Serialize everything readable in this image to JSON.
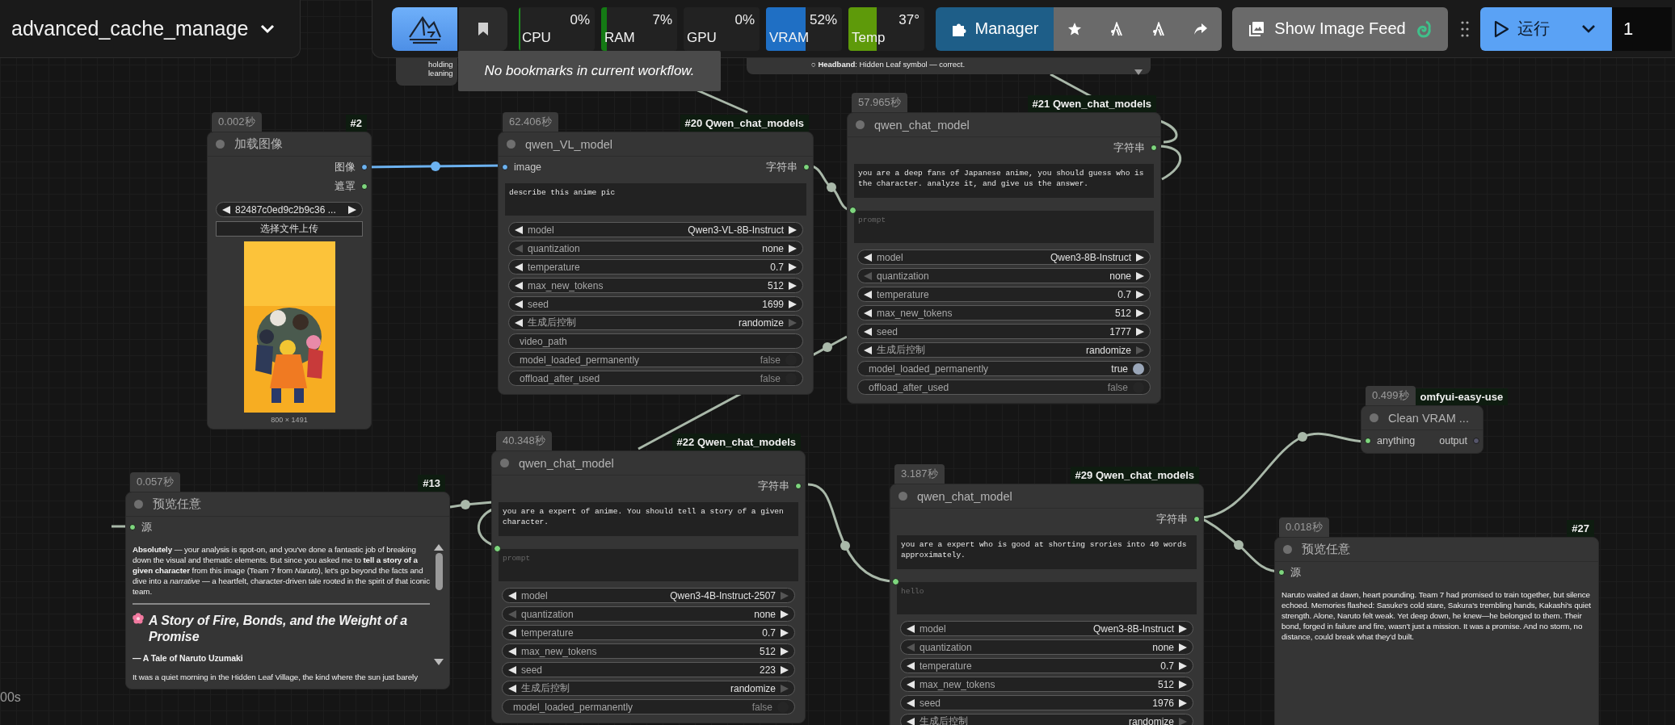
{
  "workflow": {
    "title": "advanced_cache_manage"
  },
  "toolbar": {
    "tooltip": "No bookmarks in current workflow.",
    "monitors": [
      {
        "label": "CPU",
        "reading": "0%",
        "level": 0.02,
        "color": "#1f8f1f"
      },
      {
        "label": "RAM",
        "reading": "7%",
        "level": 0.07,
        "color": "#147a14"
      },
      {
        "label": "GPU",
        "reading": "0%"
      },
      {
        "label": "VRAM",
        "reading": "52%",
        "level": 0.52,
        "color": "#1f6fc4"
      },
      {
        "label": "Temp",
        "reading": "37°",
        "level": 0.37,
        "color": "#5e9a0a"
      }
    ],
    "manager": "Manager",
    "image_feed": "Show Image Feed",
    "run": "运行",
    "queue_count": "1"
  },
  "partial_nodes": [
    {
      "lines": [
        "holding",
        "leaning"
      ]
    },
    {
      "lines": [
        "○ **Headband**: Hidden Leaf symbol — correct."
      ]
    }
  ],
  "nodes": [
    {
      "kind": "load_image",
      "badge": "0.002秒",
      "tag": "#2",
      "title": "加载图像",
      "outputs": [
        {
          "label": "图像",
          "color": "#6cb2f0"
        },
        {
          "label": "遮罩",
          "color": "#7ed67e"
        }
      ],
      "file": "82487c0ed9c2b9c36 ...",
      "upload": "选择文件上传",
      "caption": "800 × 1491"
    },
    {
      "kind": "qwen",
      "badge": "62.406秒",
      "tag": "#20 Qwen_chat_models",
      "title": "qwen_VL_model",
      "inputs": [
        {
          "label": "image",
          "color": "#6cb2f0"
        }
      ],
      "outputs": [
        {
          "label": "字符串",
          "color": "#7ed67e"
        }
      ],
      "system_text": "describe this anime pic",
      "widgets": [
        {
          "kind": "combo",
          "label": "model",
          "value": "Qwen3-VL-8B-Instruct",
          "prev_disabled": false,
          "next_disabled": false
        },
        {
          "kind": "combo",
          "label": "quantization",
          "value": "none",
          "prev_disabled": true,
          "next_disabled": false
        },
        {
          "kind": "number",
          "label": "temperature",
          "value": "0.7",
          "prev_disabled": false,
          "next_disabled": false
        },
        {
          "kind": "number",
          "label": "max_new_tokens",
          "value": "512",
          "prev_disabled": false,
          "next_disabled": false
        },
        {
          "kind": "number",
          "label": "seed",
          "value": "1699",
          "prev_disabled": false,
          "next_disabled": false
        },
        {
          "kind": "combo",
          "label": "生成后控制",
          "value": "randomize",
          "prev_disabled": false,
          "next_disabled": true
        },
        {
          "kind": "text",
          "label": "video_path"
        },
        {
          "kind": "toggle",
          "label": "model_loaded_permanently",
          "value": "false",
          "on": false
        },
        {
          "kind": "toggle",
          "label": "offload_after_used",
          "value": "false",
          "on": false
        }
      ]
    },
    {
      "kind": "qwen",
      "badge": "57.965秒",
      "tag": "#21 Qwen_chat_models",
      "title": "qwen_chat_model",
      "outputs": [
        {
          "label": "字符串",
          "color": "#7ed67e"
        }
      ],
      "system_text": "you are a deep fans of Japanese anime, you should guess who is the character. analyze it, and give us the answer.",
      "prompt": {
        "placeholder": "prompt"
      },
      "widgets": [
        {
          "kind": "combo",
          "label": "model",
          "value": "Qwen3-8B-Instruct",
          "prev_disabled": false,
          "next_disabled": false
        },
        {
          "kind": "combo",
          "label": "quantization",
          "value": "none",
          "prev_disabled": true,
          "next_disabled": false
        },
        {
          "kind": "number",
          "label": "temperature",
          "value": "0.7",
          "prev_disabled": false,
          "next_disabled": false
        },
        {
          "kind": "number",
          "label": "max_new_tokens",
          "value": "512",
          "prev_disabled": false,
          "next_disabled": false
        },
        {
          "kind": "number",
          "label": "seed",
          "value": "1777",
          "prev_disabled": false,
          "next_disabled": false
        },
        {
          "kind": "combo",
          "label": "生成后控制",
          "value": "randomize",
          "prev_disabled": false,
          "next_disabled": true
        },
        {
          "kind": "toggle",
          "label": "model_loaded_permanently",
          "value": "true",
          "on": true
        },
        {
          "kind": "toggle",
          "label": "offload_after_used",
          "value": "false",
          "on": false
        }
      ]
    },
    {
      "kind": "preview",
      "badge": "0.057秒",
      "tag": "#13",
      "title": "预览任意",
      "inputs": [
        {
          "label": "源",
          "color": "#7ed67e"
        }
      ],
      "content": [
        {
          "kind": "paragraph",
          "text": "**Absolutely** — your analysis is spot-on, and you've done a fantastic job of breaking down the visual and thematic elements. But since you asked me to **tell a story of a given character** from this image (Team 7 from *Naruto*), let's go beyond the facts and dive into a *narrative* — a heartfelt, character-driven tale rooted in the spirit of that iconic team."
        },
        {
          "kind": "rule"
        },
        {
          "kind": "heading",
          "text": "A Story of Fire, Bonds, and the Weight of a Promise"
        },
        {
          "kind": "subheading",
          "text": "— A Tale of Naruto Uzumaki"
        },
        {
          "kind": "paragraph",
          "text": "It was a quiet morning in the Hidden Leaf Village, the kind where the sun just barely"
        }
      ]
    },
    {
      "kind": "qwen",
      "badge": "40.348秒",
      "tag": "#22 Qwen_chat_models",
      "title": "qwen_chat_model",
      "outputs": [
        {
          "label": "字符串",
          "color": "#7ed67e"
        }
      ],
      "system_text": "you are a expert of anime. You should tell a story of a given character.",
      "prompt": {
        "placeholder": "prompt"
      },
      "widgets": [
        {
          "kind": "combo",
          "label": "model",
          "value": "Qwen3-4B-Instruct-2507",
          "prev_disabled": false,
          "next_disabled": true
        },
        {
          "kind": "combo",
          "label": "quantization",
          "value": "none",
          "prev_disabled": true,
          "next_disabled": false
        },
        {
          "kind": "number",
          "label": "temperature",
          "value": "0.7",
          "prev_disabled": false,
          "next_disabled": false
        },
        {
          "kind": "number",
          "label": "max_new_tokens",
          "value": "512",
          "prev_disabled": false,
          "next_disabled": false
        },
        {
          "kind": "number",
          "label": "seed",
          "value": "223",
          "prev_disabled": false,
          "next_disabled": false
        },
        {
          "kind": "combo",
          "label": "生成后控制",
          "value": "randomize",
          "prev_disabled": false,
          "next_disabled": true
        },
        {
          "kind": "toggle",
          "label": "model_loaded_permanently",
          "value": "false",
          "on": false
        }
      ]
    },
    {
      "kind": "qwen",
      "badge": "3.187秒",
      "tag": "#29 Qwen_chat_models",
      "title": "qwen_chat_model",
      "outputs": [
        {
          "label": "字符串",
          "color": "#7ed67e"
        }
      ],
      "system_text": "you are a expert who is good at shorting srories into 40 words approximately.",
      "prompt": {
        "placeholder": "hello"
      },
      "widgets": [
        {
          "kind": "combo",
          "label": "model",
          "value": "Qwen3-8B-Instruct",
          "prev_disabled": false,
          "next_disabled": false
        },
        {
          "kind": "combo",
          "label": "quantization",
          "value": "none",
          "prev_disabled": true,
          "next_disabled": false
        },
        {
          "kind": "number",
          "label": "temperature",
          "value": "0.7",
          "prev_disabled": false,
          "next_disabled": false
        },
        {
          "kind": "number",
          "label": "max_new_tokens",
          "value": "512",
          "prev_disabled": false,
          "next_disabled": false
        },
        {
          "kind": "number",
          "label": "seed",
          "value": "1976",
          "prev_disabled": false,
          "next_disabled": false
        },
        {
          "kind": "combo",
          "label": "生成后控制",
          "value": "randomize",
          "prev_disabled": false,
          "next_disabled": true
        }
      ]
    },
    {
      "kind": "clean_vram",
      "badge": "0.499秒",
      "tag": "omfyui-easy-use",
      "title": "Clean VRAM ...",
      "inputs": [
        {
          "label": "anything",
          "color": "#7ed67e"
        }
      ],
      "outputs": [
        {
          "label": "output",
          "color": "#55556a"
        }
      ]
    },
    {
      "kind": "preview",
      "badge": "0.018秒",
      "tag": "#27",
      "title": "预览任意",
      "inputs": [
        {
          "label": "源",
          "color": "#7ed67e"
        }
      ],
      "content": [
        {
          "kind": "paragraph",
          "text": "Naruto waited at dawn, heart pounding. Team 7 had promised to train together, but silence echoed. Memories flashed: Sasuke's cold stare, Sakura's trembling hands, Kakashi's quiet strength. Alone, Naruto felt weak. Yet deep down, he knew—he belonged to them. Their bond, forged in failure and fire, wasn't just a mission. It was a promise. And no storm, no distance, could break what they'd built."
        }
      ]
    }
  ],
  "canvas_label": "00s"
}
